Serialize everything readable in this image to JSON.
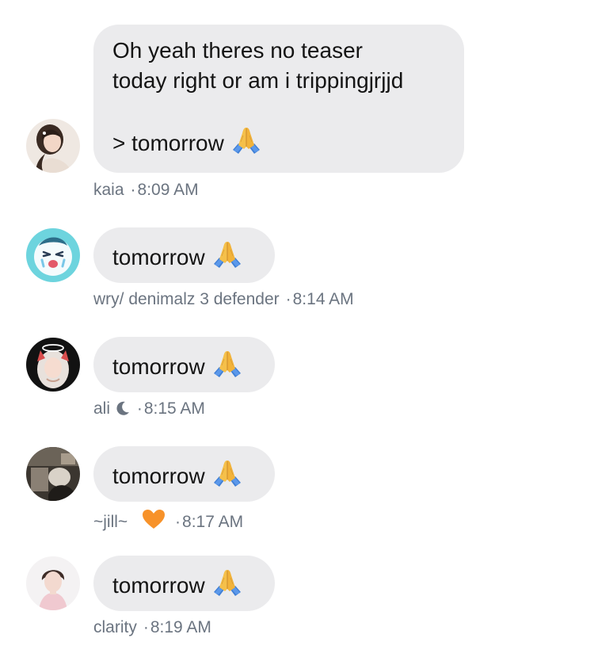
{
  "messages": [
    {
      "author": "kaia",
      "time": "8:09 AM",
      "lines": [
        "Oh yeah theres no teaser",
        "today right or am i trippingjrjjd",
        "",
        "> tomorrow"
      ],
      "emoji": "folded-hands"
    },
    {
      "author": "wry/ denimalz 3 defender",
      "time": "8:14 AM",
      "text": "tomorrow",
      "emoji": "folded-hands"
    },
    {
      "author": "ali",
      "author_icon": "crescent-moon-icon",
      "time": "8:15 AM",
      "text": "tomorrow",
      "emoji": "folded-hands"
    },
    {
      "author": "~jill~",
      "author_icon": "orange-heart-icon",
      "time": "8:17 AM",
      "text": "tomorrow",
      "emoji": "folded-hands"
    },
    {
      "author": "clarity",
      "time": "8:19 AM",
      "text": "tomorrow",
      "emoji": "folded-hands"
    }
  ],
  "separator": "·",
  "colors": {
    "bubble": "#ebebed",
    "text": "#141414",
    "meta": "#6b7480",
    "heart": "#f7922a"
  }
}
